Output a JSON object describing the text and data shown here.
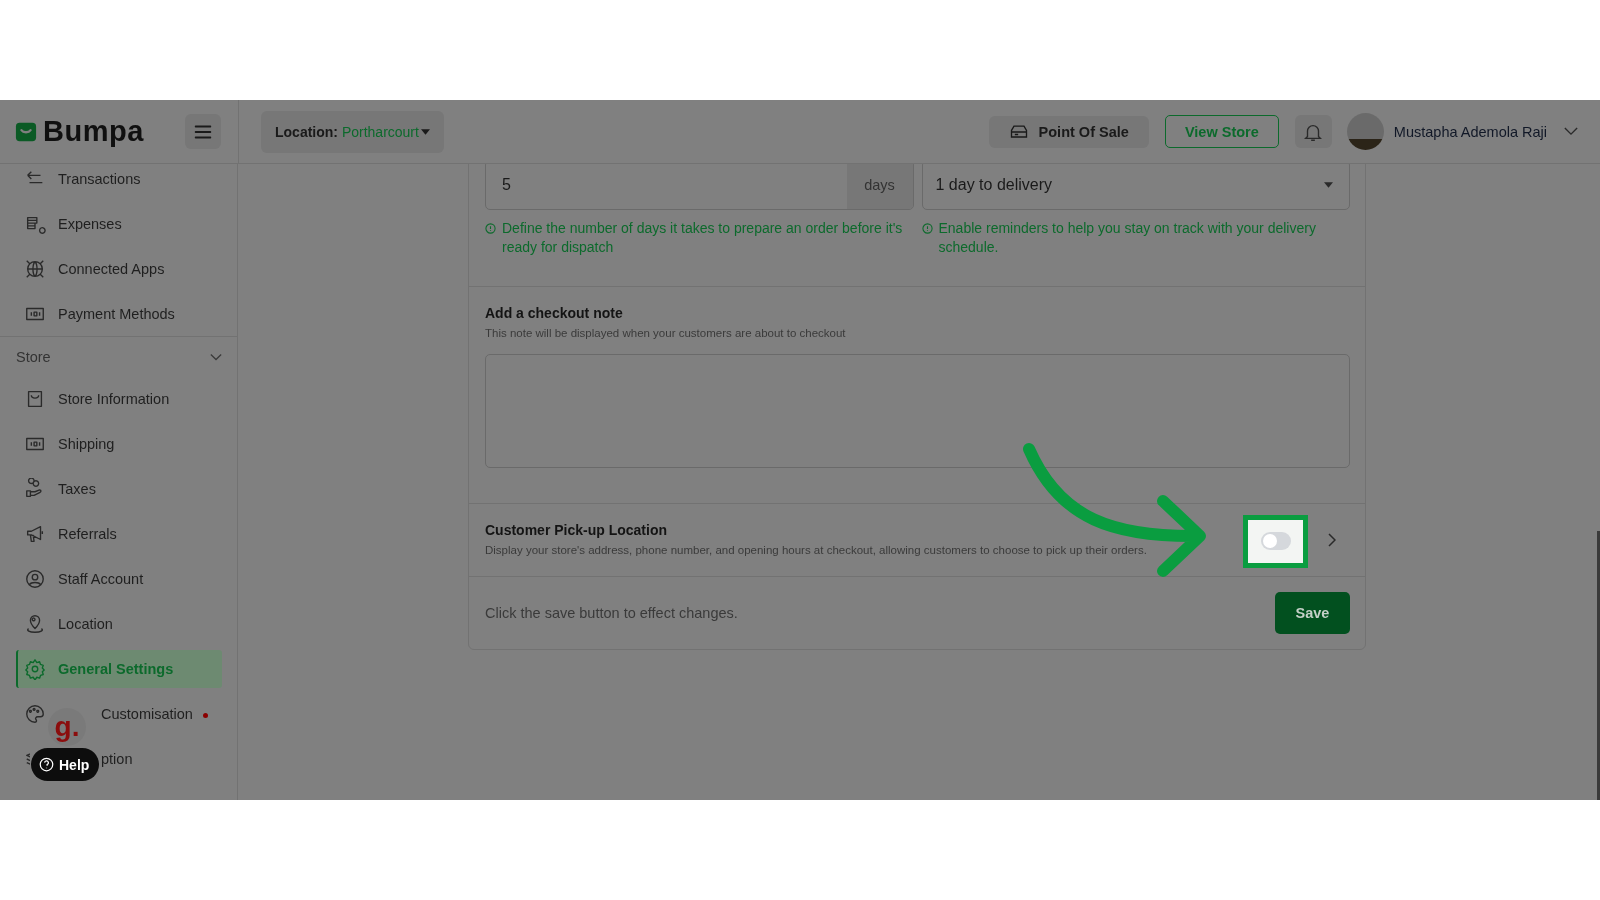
{
  "brand": "Bumpa",
  "header": {
    "location_label": "Location:",
    "location_value": "Portharcourt",
    "point_of_sale": "Point Of Sale",
    "view_store": "View Store",
    "user_name": "Mustapha Ademola Raji"
  },
  "sidebar": {
    "top_items": [
      {
        "label": "Transactions",
        "selected": false
      },
      {
        "label": "Expenses",
        "selected": false
      },
      {
        "label": "Connected Apps",
        "selected": false
      },
      {
        "label": "Payment Methods",
        "selected": false
      }
    ],
    "section": {
      "title": "Store",
      "expanded": true
    },
    "store_items": [
      {
        "label": "Store Information",
        "selected": false,
        "covered": false
      },
      {
        "label": "Shipping",
        "selected": false,
        "covered": false
      },
      {
        "label": "Taxes",
        "selected": false,
        "covered": false
      },
      {
        "label": "Referrals",
        "selected": false,
        "covered": false
      },
      {
        "label": "Staff Account",
        "selected": false,
        "covered": false
      },
      {
        "label": "Location",
        "selected": false,
        "covered": false
      },
      {
        "label": "General Settings",
        "selected": true,
        "covered": false
      },
      {
        "label": "Customisation",
        "selected": false,
        "covered": true,
        "dot": true
      },
      {
        "label": "ption",
        "selected": false,
        "covered": true
      }
    ]
  },
  "preparation": {
    "value": "5",
    "unit": "days",
    "hint": "Define the number of days it takes to prepare an order before it's ready for dispatch"
  },
  "reminder": {
    "value": "1 day to delivery",
    "hint": "Enable reminders to help you stay on track with your delivery schedule."
  },
  "checkout_note": {
    "title": "Add a checkout note",
    "subtitle": "This note will be displayed when your customers are about to checkout"
  },
  "pickup": {
    "title": "Customer Pick-up Location",
    "description": "Display your store's address, phone number, and opening hours at checkout, allowing customers to choose to pick up their orders.",
    "on": false,
    "highlighted": true
  },
  "footer": {
    "text": "Click the save button to effect changes.",
    "save": "Save"
  },
  "help": {
    "label": "Help",
    "chat_badge": "g."
  }
}
